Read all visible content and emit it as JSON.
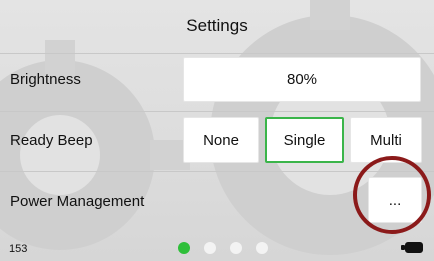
{
  "header": {
    "title": "Settings"
  },
  "settings": {
    "brightness": {
      "label": "Brightness",
      "value": "80%"
    },
    "ready_beep": {
      "label": "Ready Beep",
      "options": [
        "None",
        "Single",
        "Multi"
      ],
      "selected": "Single"
    },
    "power_management": {
      "label": "Power Management",
      "button_label": "..."
    }
  },
  "footer": {
    "number": "153",
    "page_indicator": {
      "pages": 4,
      "active_page": 1
    }
  },
  "colors": {
    "selected_border": "#3bb54a",
    "active_dot": "#2fbf3a",
    "highlight_ring": "#8b1a1a"
  },
  "icons": {
    "battery": "battery-icon",
    "background": "gear-icon"
  }
}
